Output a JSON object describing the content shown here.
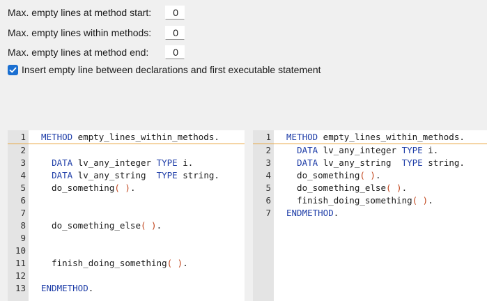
{
  "settings": {
    "start_label": "Max. empty lines at method start:",
    "start_value": "0",
    "within_label": "Max. empty lines within methods:",
    "within_value": "0",
    "end_label": "Max. empty lines at method end:",
    "end_value": "0",
    "insert_label": "Insert empty line between declarations and first executable statement",
    "insert_checked": true
  },
  "colors": {
    "keyword": "#1f3ea8",
    "paren": "#c0431a",
    "checkbox": "#1a6fd1",
    "highlight_line": "#e8a33a"
  },
  "left_editor": {
    "lines": [
      {
        "n": "1",
        "t": [
          {
            "k": "kw",
            "s": "METHOD"
          },
          {
            "k": "ident",
            "s": " empty_lines_within_methods."
          }
        ]
      },
      {
        "n": "2",
        "t": []
      },
      {
        "n": "3",
        "t": [
          {
            "k": "ident",
            "s": "  "
          },
          {
            "k": "kw",
            "s": "DATA"
          },
          {
            "k": "ident",
            "s": " lv_any_integer "
          },
          {
            "k": "kw",
            "s": "TYPE"
          },
          {
            "k": "ident",
            "s": " i."
          }
        ]
      },
      {
        "n": "4",
        "t": [
          {
            "k": "ident",
            "s": "  "
          },
          {
            "k": "kw",
            "s": "DATA"
          },
          {
            "k": "ident",
            "s": " lv_any_string  "
          },
          {
            "k": "kw",
            "s": "TYPE"
          },
          {
            "k": "ident",
            "s": " string."
          }
        ]
      },
      {
        "n": "5",
        "t": [
          {
            "k": "ident",
            "s": "  do_something"
          },
          {
            "k": "paren",
            "s": "( )"
          },
          {
            "k": "ident",
            "s": "."
          }
        ]
      },
      {
        "n": "6",
        "t": []
      },
      {
        "n": "7",
        "t": []
      },
      {
        "n": "8",
        "t": [
          {
            "k": "ident",
            "s": "  do_something_else"
          },
          {
            "k": "paren",
            "s": "( )"
          },
          {
            "k": "ident",
            "s": "."
          }
        ]
      },
      {
        "n": "9",
        "t": []
      },
      {
        "n": "10",
        "t": []
      },
      {
        "n": "11",
        "t": [
          {
            "k": "ident",
            "s": "  finish_doing_something"
          },
          {
            "k": "paren",
            "s": "( )"
          },
          {
            "k": "ident",
            "s": "."
          }
        ]
      },
      {
        "n": "12",
        "t": []
      },
      {
        "n": "13",
        "t": [
          {
            "k": "kw",
            "s": "ENDMETHOD"
          },
          {
            "k": "ident",
            "s": "."
          }
        ]
      }
    ]
  },
  "right_editor": {
    "lines": [
      {
        "n": "1",
        "t": [
          {
            "k": "kw",
            "s": "METHOD"
          },
          {
            "k": "ident",
            "s": " empty_lines_within_methods."
          }
        ]
      },
      {
        "n": "2",
        "t": [
          {
            "k": "ident",
            "s": "  "
          },
          {
            "k": "kw",
            "s": "DATA"
          },
          {
            "k": "ident",
            "s": " lv_any_integer "
          },
          {
            "k": "kw",
            "s": "TYPE"
          },
          {
            "k": "ident",
            "s": " i."
          }
        ]
      },
      {
        "n": "3",
        "t": [
          {
            "k": "ident",
            "s": "  "
          },
          {
            "k": "kw",
            "s": "DATA"
          },
          {
            "k": "ident",
            "s": " lv_any_string  "
          },
          {
            "k": "kw",
            "s": "TYPE"
          },
          {
            "k": "ident",
            "s": " string."
          }
        ]
      },
      {
        "n": "4",
        "t": [
          {
            "k": "ident",
            "s": "  do_something"
          },
          {
            "k": "paren",
            "s": "( )"
          },
          {
            "k": "ident",
            "s": "."
          }
        ]
      },
      {
        "n": "5",
        "t": [
          {
            "k": "ident",
            "s": "  do_something_else"
          },
          {
            "k": "paren",
            "s": "( )"
          },
          {
            "k": "ident",
            "s": "."
          }
        ]
      },
      {
        "n": "6",
        "t": [
          {
            "k": "ident",
            "s": "  finish_doing_something"
          },
          {
            "k": "paren",
            "s": "( )"
          },
          {
            "k": "ident",
            "s": "."
          }
        ]
      },
      {
        "n": "7",
        "t": [
          {
            "k": "kw",
            "s": "ENDMETHOD"
          },
          {
            "k": "ident",
            "s": "."
          }
        ]
      }
    ]
  }
}
